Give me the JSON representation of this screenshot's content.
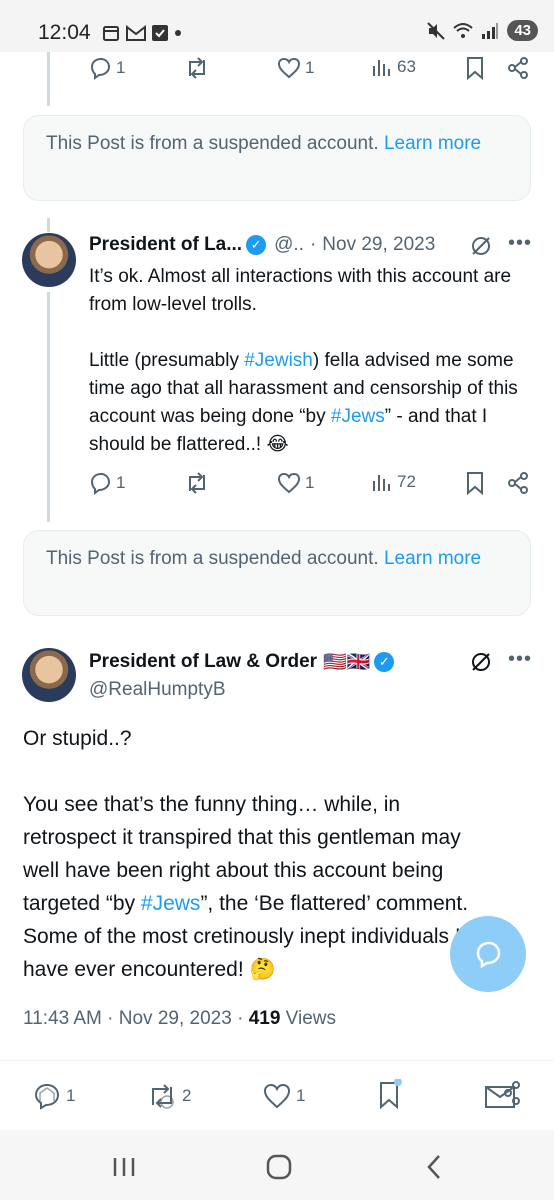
{
  "status_bar": {
    "time": "12:04",
    "battery": "43",
    "icons_left": [
      "calendar-icon",
      "gmail-icon",
      "check-icon",
      "dot-icon"
    ],
    "icons_right": [
      "mute-icon",
      "wifi-icon",
      "signal-icon"
    ]
  },
  "post0_actions": {
    "replies": "1",
    "reposts": "",
    "likes": "1",
    "views": "63"
  },
  "suspended_notice": {
    "text": "This Post is from a suspended account.",
    "link": "Learn more"
  },
  "reply_post": {
    "name": "President of La...",
    "handle": "@..",
    "separator": "·",
    "date": "Nov 29, 2023",
    "para1": "It’s ok. Almost all interactions with this account are from low-level trolls.",
    "para2_before": "Little (presumably ",
    "para2_hashtag1": "#Jewish",
    "para2_middle": ") fella advised me some time ago that all harassment and censorship of this account was being done “by ",
    "para2_hashtag2": "#Jews",
    "para2_after": "” - and that I should be flattered..! 😂",
    "actions": {
      "replies": "1",
      "likes": "1",
      "views": "72"
    }
  },
  "suspended_notice_2": {
    "text": "This Post is from a suspended account.",
    "link": "Learn more"
  },
  "main_post": {
    "name": "President of Law & Order",
    "flags": "🇺🇸🇬🇧",
    "handle": "@RealHumptyB",
    "line1": "Or stupid..?",
    "para_before": "You see that’s the funny thing… while, in retrospect it transpired that this gentleman may well have been right about this account being targeted “by ",
    "hashtag": "#Jews",
    "para_after": "”, the ‘Be flattered’ comment. Some of the most cretinously inept individuals I have ever encountered! 🤔",
    "time": "11:43 AM",
    "dot": "·",
    "date": "Nov 29, 2023",
    "views_count": "419",
    "views_label": "Views"
  },
  "bottom_actions": {
    "replies": "1",
    "reposts": "2",
    "likes": "1"
  },
  "colors": {
    "accent": "#1d9bf0",
    "text": "#0f1419",
    "muted": "#536471"
  }
}
